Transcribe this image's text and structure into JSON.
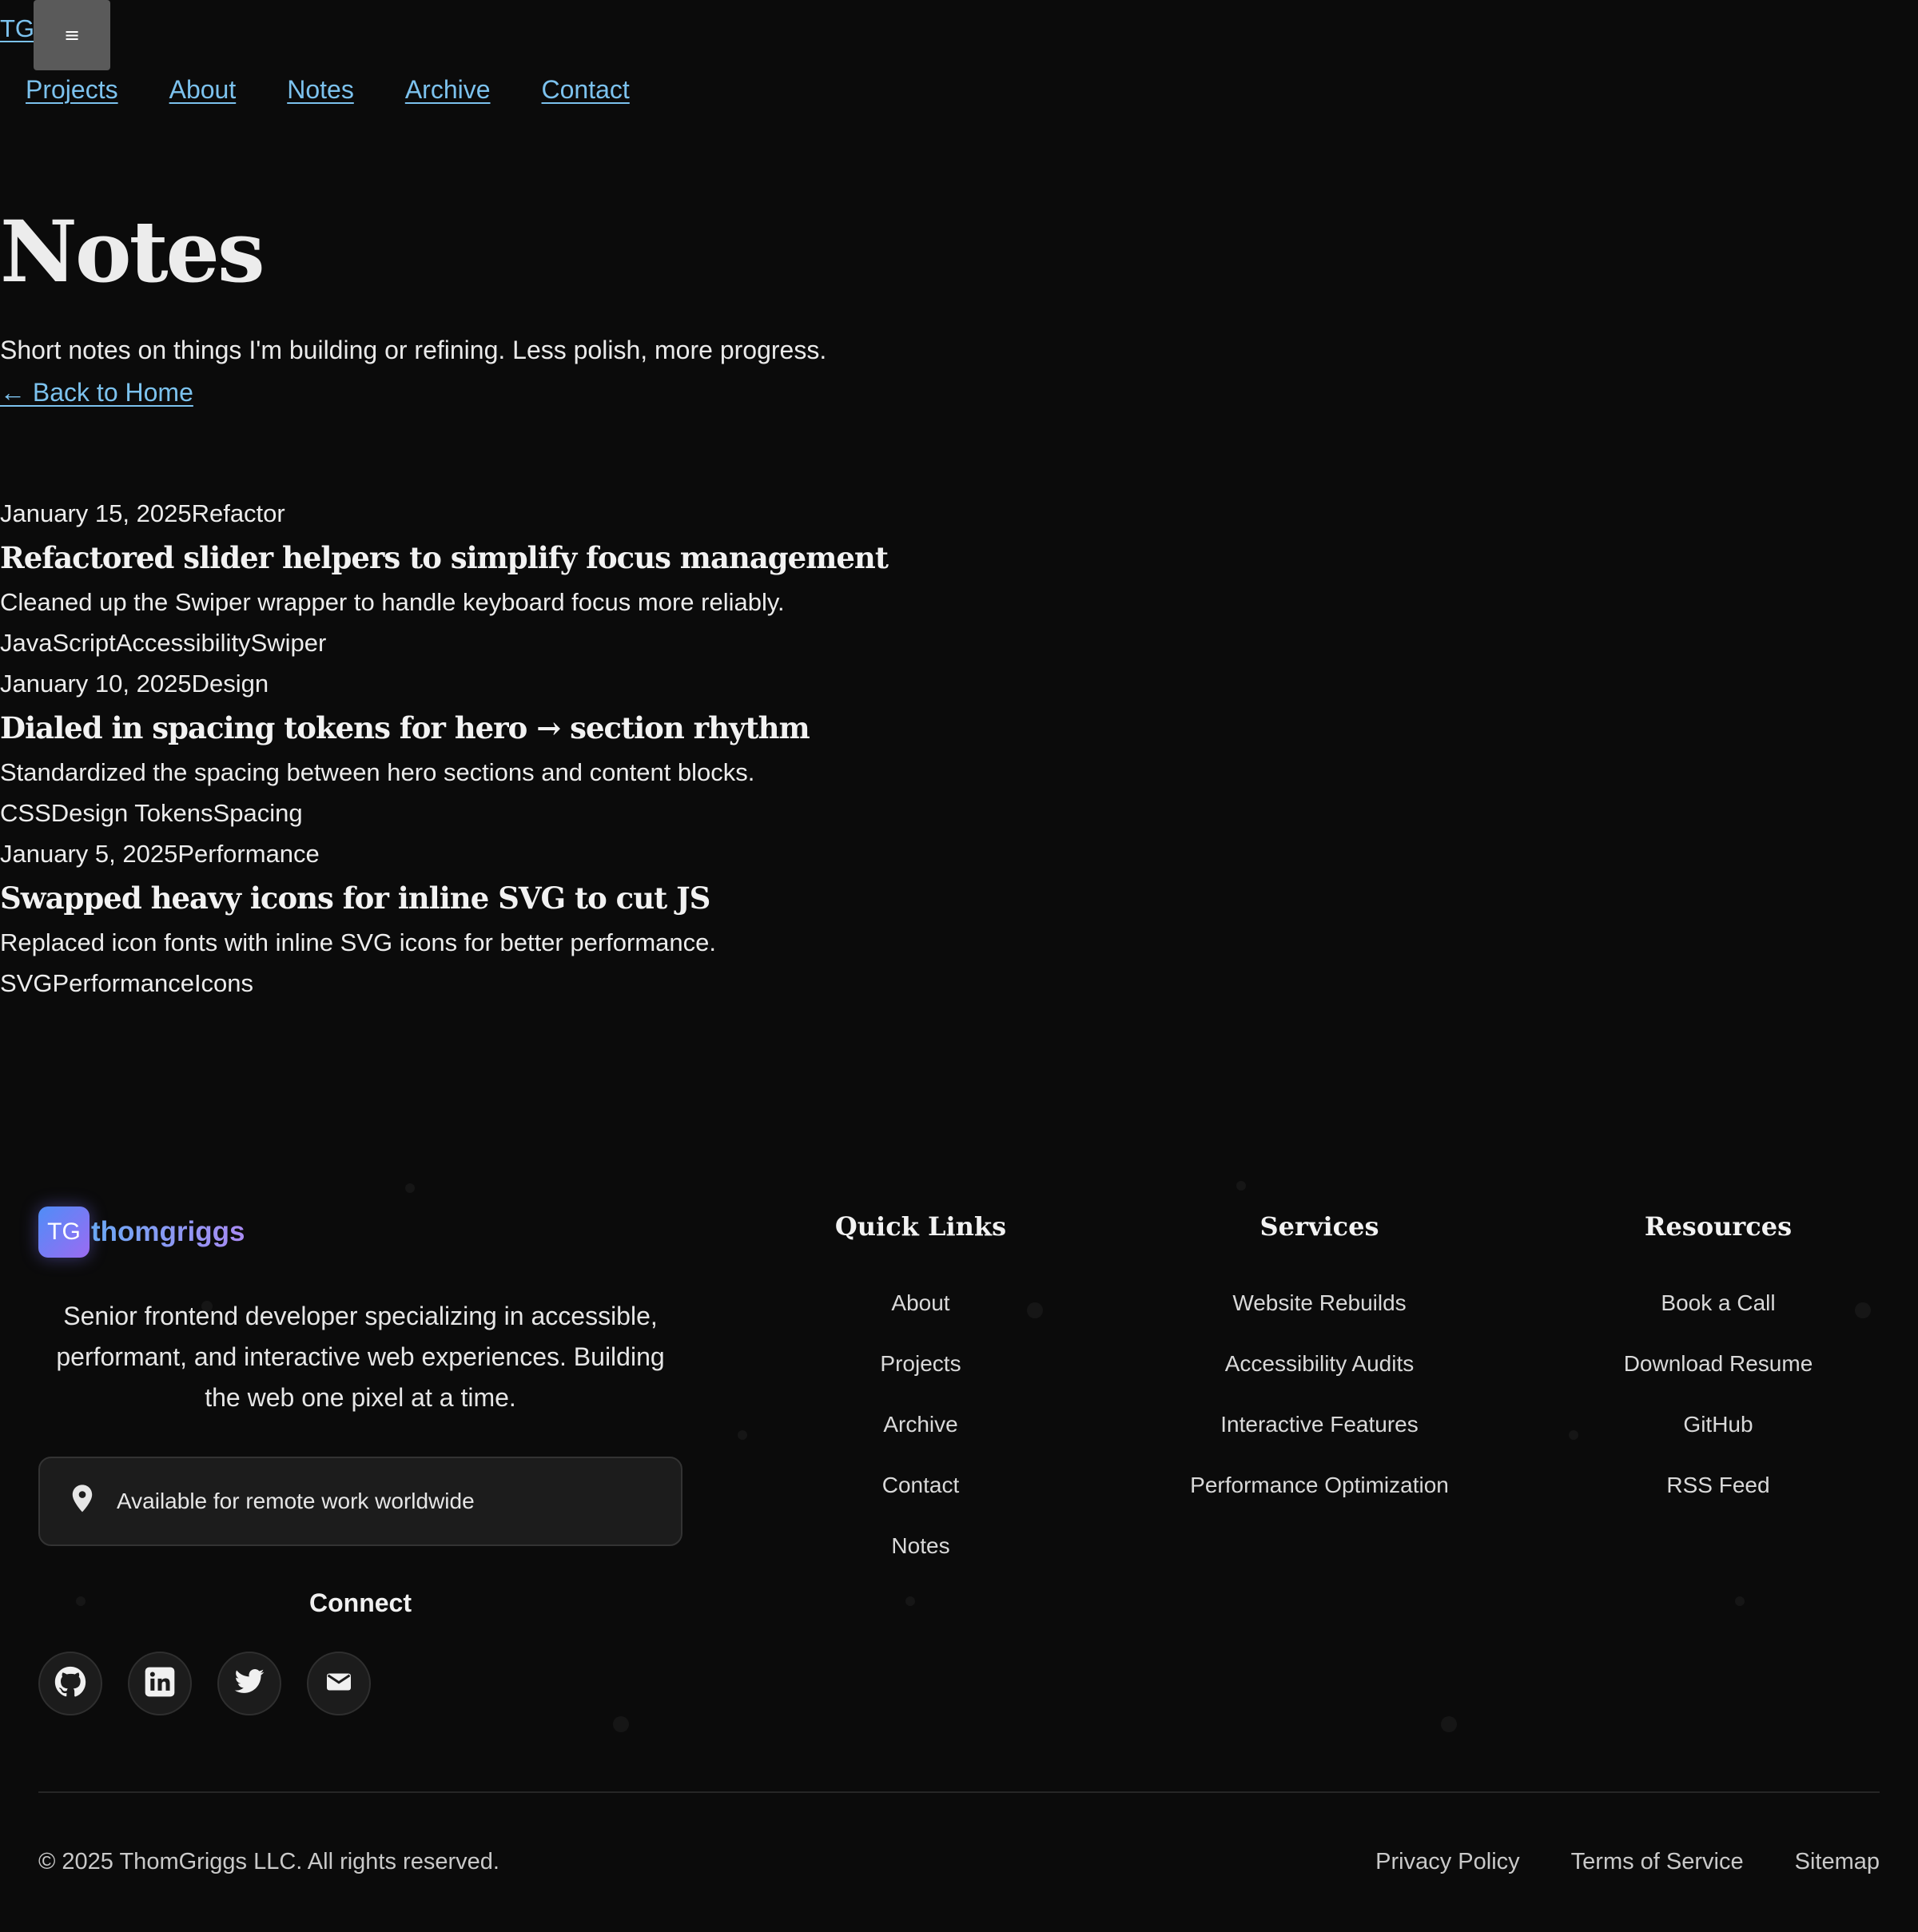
{
  "header": {
    "brand": "TG",
    "menu_icon": "≡",
    "nav": [
      "Projects",
      "About",
      "Notes",
      "Archive",
      "Contact"
    ]
  },
  "hero": {
    "title": "Notes",
    "intro": "Short notes on things I'm building or refining. Less polish, more progress.",
    "back_link": "← Back to Home"
  },
  "notes": [
    {
      "date": "January 15, 2025",
      "category": "Refactor",
      "title": "Refactored slider helpers to simplify focus management",
      "summary": "Cleaned up the Swiper wrapper to handle keyboard focus more reliably.",
      "tags": [
        "JavaScript",
        "Accessibility",
        "Swiper"
      ]
    },
    {
      "date": "January 10, 2025",
      "category": "Design",
      "title": "Dialed in spacing tokens for hero → section rhythm",
      "summary": "Standardized the spacing between hero sections and content blocks.",
      "tags": [
        "CSS",
        "Design Tokens",
        "Spacing"
      ]
    },
    {
      "date": "January 5, 2025",
      "category": "Performance",
      "title": "Swapped heavy icons for inline SVG to cut JS",
      "summary": "Replaced icon fonts with inline SVG icons for better performance.",
      "tags": [
        "SVG",
        "Performance",
        "Icons"
      ]
    }
  ],
  "footer": {
    "logo_initials": "TG",
    "brand_name": "thomgriggs",
    "bio": "Senior frontend developer specializing in accessible, performant, and interactive web experiences. Building the web one pixel at a time.",
    "availability": "Available for remote work worldwide",
    "availability_icon": "location-pin-icon",
    "connect_heading": "Connect",
    "social_icons": [
      "github-icon",
      "linkedin-icon",
      "twitter-icon",
      "email-icon"
    ],
    "columns": [
      {
        "heading": "Quick Links",
        "links": [
          "About",
          "Projects",
          "Archive",
          "Contact",
          "Notes"
        ]
      },
      {
        "heading": "Services",
        "links": [
          "Website Rebuilds",
          "Accessibility Audits",
          "Interactive Features",
          "Performance Optimization"
        ]
      },
      {
        "heading": "Resources",
        "links": [
          "Book a Call",
          "Download Resume",
          "GitHub",
          "RSS Feed"
        ]
      }
    ],
    "copyright": "© 2025 ThomGriggs LLC. All rights reserved.",
    "legal_links": [
      "Privacy Policy",
      "Terms of Service",
      "Sitemap"
    ]
  },
  "colors": {
    "background": "#0b0b0b",
    "link": "#7cc2ee",
    "accent_gradient_start": "#4f8df7",
    "accent_gradient_end": "#9b6bf2"
  }
}
